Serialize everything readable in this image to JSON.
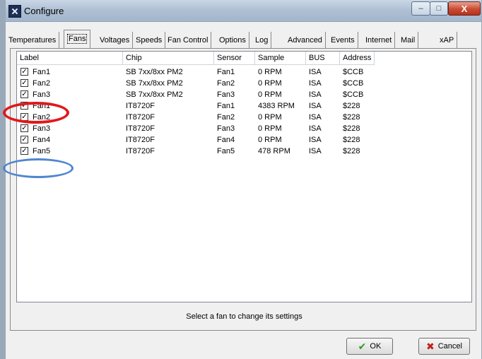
{
  "window": {
    "title": "Configure",
    "buttons": {
      "minimize": "–",
      "maximize": "□",
      "close": "X"
    }
  },
  "tabs": [
    {
      "label": "Temperatures",
      "active": false
    },
    {
      "label": "Fans",
      "active": true
    },
    {
      "label": "Voltages",
      "active": false
    },
    {
      "label": "Speeds",
      "active": false
    },
    {
      "label": "Fan Control",
      "active": false
    },
    {
      "label": "Options",
      "active": false
    },
    {
      "label": "Log",
      "active": false
    },
    {
      "label": "Advanced",
      "active": false
    },
    {
      "label": "Events",
      "active": false
    },
    {
      "label": "Internet",
      "active": false
    },
    {
      "label": "Mail",
      "active": false
    },
    {
      "label": "xAP",
      "active": false
    }
  ],
  "list": {
    "columns": [
      "Label",
      "Chip",
      "Sensor",
      "Sample",
      "BUS",
      "Address"
    ],
    "rows": [
      {
        "checked": true,
        "label": "Fan1",
        "chip": "SB 7xx/8xx PM2",
        "sensor": "Fan1",
        "sample": "0 RPM",
        "bus": "ISA",
        "address": "$CCB"
      },
      {
        "checked": true,
        "label": "Fan2",
        "chip": "SB 7xx/8xx PM2",
        "sensor": "Fan2",
        "sample": "0 RPM",
        "bus": "ISA",
        "address": "$CCB"
      },
      {
        "checked": true,
        "label": "Fan3",
        "chip": "SB 7xx/8xx PM2",
        "sensor": "Fan3",
        "sample": "0 RPM",
        "bus": "ISA",
        "address": "$CCB"
      },
      {
        "checked": true,
        "label": "Fan1",
        "chip": "IT8720F",
        "sensor": "Fan1",
        "sample": "4383 RPM",
        "bus": "ISA",
        "address": "$228"
      },
      {
        "checked": true,
        "label": "Fan2",
        "chip": "IT8720F",
        "sensor": "Fan2",
        "sample": "0 RPM",
        "bus": "ISA",
        "address": "$228"
      },
      {
        "checked": true,
        "label": "Fan3",
        "chip": "IT8720F",
        "sensor": "Fan3",
        "sample": "0 RPM",
        "bus": "ISA",
        "address": "$228"
      },
      {
        "checked": true,
        "label": "Fan4",
        "chip": "IT8720F",
        "sensor": "Fan4",
        "sample": "0 RPM",
        "bus": "ISA",
        "address": "$228"
      },
      {
        "checked": true,
        "label": "Fan5",
        "chip": "IT8720F",
        "sensor": "Fan5",
        "sample": "478 RPM",
        "bus": "ISA",
        "address": "$228"
      }
    ]
  },
  "status_text": "Select a fan to change its settings",
  "footer": {
    "ok_label": "OK",
    "cancel_label": "Cancel"
  },
  "colors": {
    "annotation_red": "#e0191b",
    "annotation_blue": "#4f86cf"
  }
}
